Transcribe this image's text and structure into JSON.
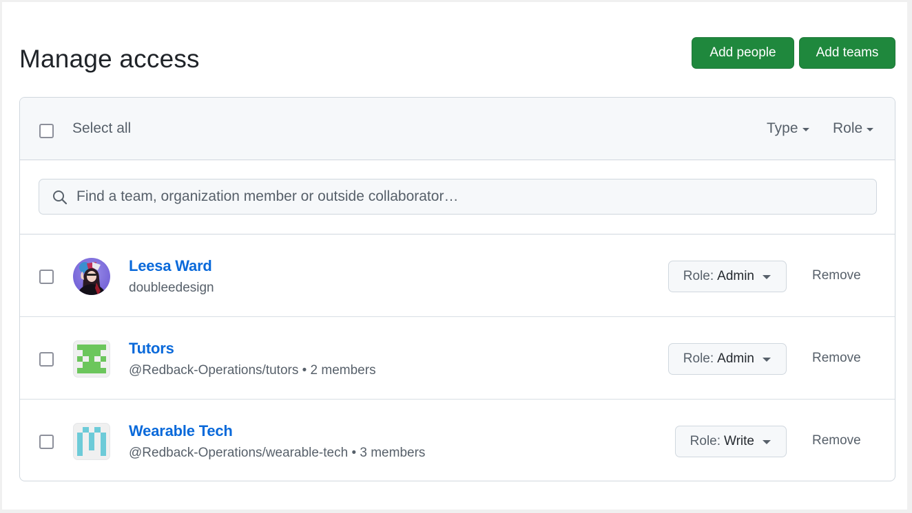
{
  "header": {
    "title": "Manage access",
    "add_people_label": "Add people",
    "add_teams_label": "Add teams"
  },
  "colors": {
    "primary_button": "#1f883d",
    "link": "#0969da",
    "muted_text": "#57606a"
  },
  "toolbar": {
    "select_all_label": "Select all",
    "select_all_checked": false,
    "filters": [
      {
        "label": "Type",
        "icon": "caret-down-icon"
      },
      {
        "label": "Role",
        "icon": "caret-down-icon"
      }
    ]
  },
  "search": {
    "placeholder": "Find a team, organization member or outside collaborator…",
    "value": "",
    "icon": "search-icon"
  },
  "members": [
    {
      "kind": "user",
      "name": "Leesa Ward",
      "subtitle": "doubleedesign",
      "role_prefix": "Role:",
      "role": "Admin",
      "remove_label": "Remove",
      "checked": false,
      "avatar": "user-photo"
    },
    {
      "kind": "team",
      "name": "Tutors",
      "subtitle": "@Redback-Operations/tutors • 2 members",
      "role_prefix": "Role:",
      "role": "Admin",
      "remove_label": "Remove",
      "checked": false,
      "avatar": "identicon",
      "identicon_color": "#6cc65c",
      "identicon_grid": [
        [
          1,
          1,
          1,
          1,
          1
        ],
        [
          0,
          1,
          1,
          1,
          0
        ],
        [
          1,
          0,
          1,
          0,
          1
        ],
        [
          0,
          1,
          1,
          1,
          0
        ],
        [
          1,
          1,
          1,
          1,
          1
        ]
      ]
    },
    {
      "kind": "team",
      "name": "Wearable Tech",
      "subtitle": "@Redback-Operations/wearable-tech • 3 members",
      "role_prefix": "Role:",
      "role": "Write",
      "remove_label": "Remove",
      "checked": false,
      "avatar": "identicon",
      "identicon_color": "#6dcbd8",
      "identicon_grid": [
        [
          0,
          1,
          0,
          1,
          0
        ],
        [
          1,
          0,
          1,
          0,
          1
        ],
        [
          1,
          0,
          1,
          0,
          1
        ],
        [
          1,
          0,
          1,
          0,
          1
        ],
        [
          1,
          0,
          0,
          0,
          1
        ]
      ]
    }
  ]
}
